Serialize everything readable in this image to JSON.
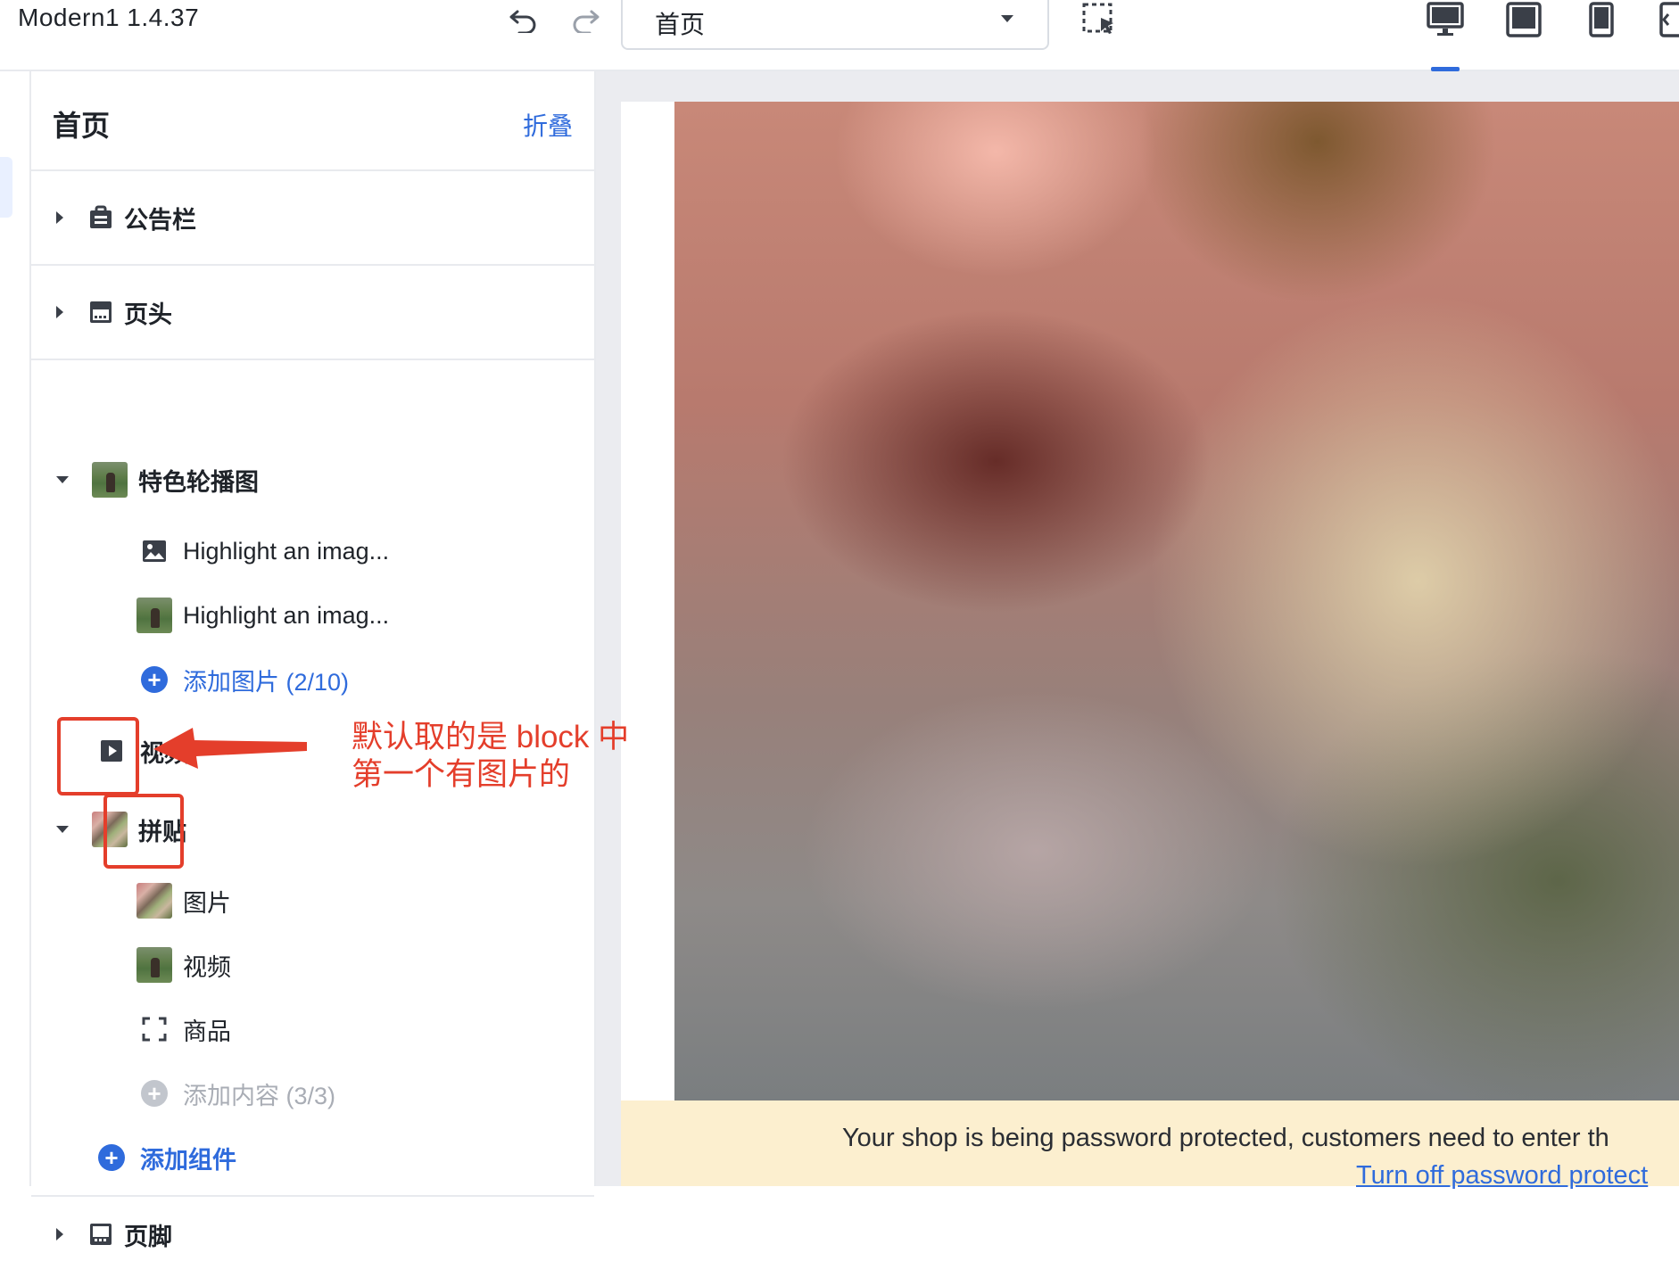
{
  "app": {
    "title": "Modern1  1.4.37"
  },
  "toolbar": {
    "undo_icon": "undo-icon",
    "redo_icon": "redo-icon",
    "page_select_value": "首页",
    "select_tool_icon": "select-area-icon",
    "devices": [
      "desktop-icon",
      "tablet-icon",
      "mobile-icon",
      "fullscreen-icon"
    ],
    "active_device": "desktop"
  },
  "sidebar": {
    "title": "首页",
    "collapse_label": "折叠",
    "sections": {
      "announcement": {
        "label": "公告栏",
        "icon": "bag-icon"
      },
      "header": {
        "label": "页头",
        "icon": "header-icon"
      },
      "slideshow": {
        "label": "特色轮播图",
        "items": [
          {
            "label": "Highlight an imag...",
            "icon": "image-icon"
          },
          {
            "label": "Highlight an imag...",
            "icon": "thumbnail"
          }
        ],
        "add_label": "添加图片 (2/10)"
      },
      "video": {
        "label": "视频",
        "icon": "play-icon"
      },
      "collage": {
        "label": "拼贴",
        "items": [
          {
            "label": "图片"
          },
          {
            "label": "视频"
          },
          {
            "label": "商品"
          }
        ],
        "add_label": "添加内容 (3/3)"
      },
      "add_component_label": "添加组件",
      "footer": {
        "label": "页脚",
        "icon": "footer-icon"
      }
    }
  },
  "annotation": {
    "line1": "默认取的是 block 中",
    "line2": "第一个有图片的",
    "color": "#e43e2b"
  },
  "preview": {
    "banner_text": "Your shop is being password protected, customers need to enter th",
    "banner_link": "Turn off password protect"
  },
  "colors": {
    "accent": "#2f6bdc",
    "banner_bg": "#fcefcf",
    "canvas_bg": "#ebecf0"
  }
}
